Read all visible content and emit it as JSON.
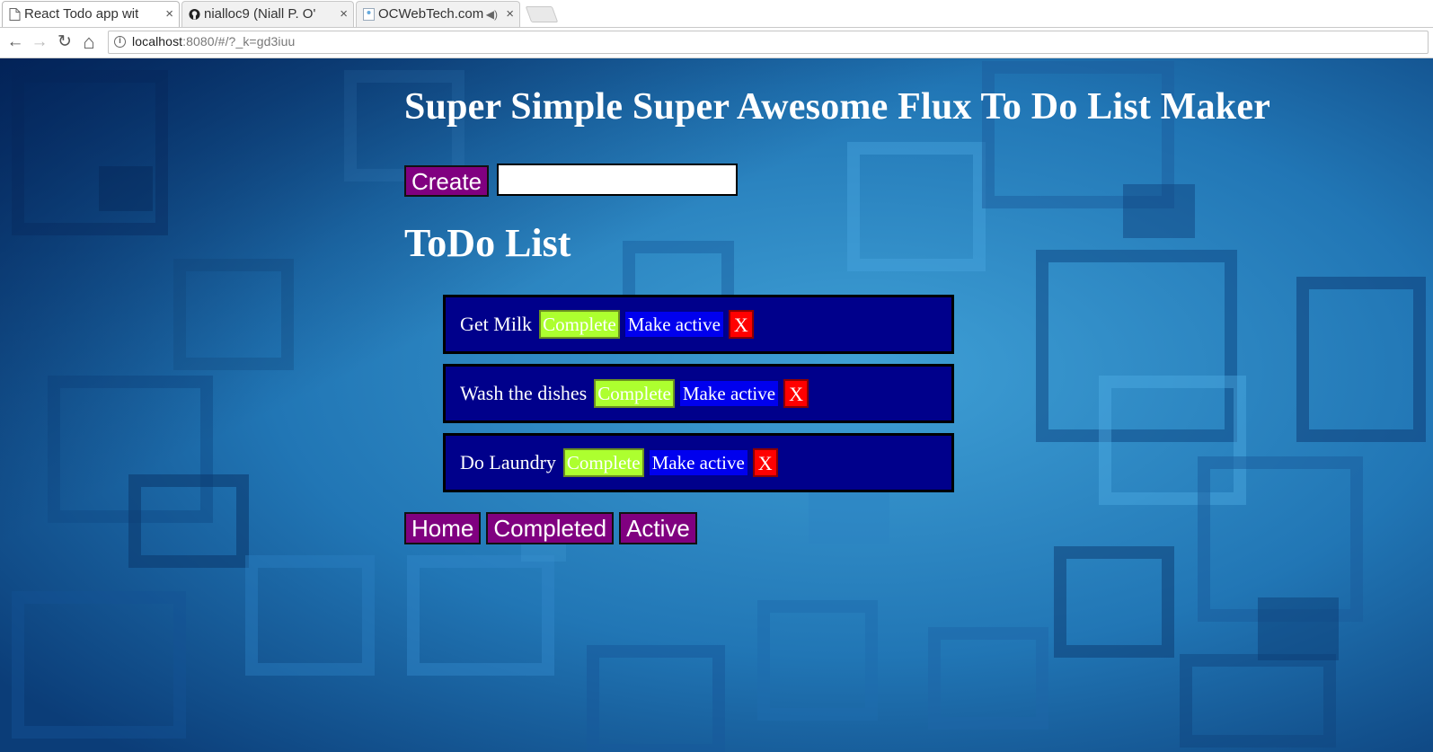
{
  "browser": {
    "tabs": [
      {
        "title": "React Todo app wit",
        "icon": "document-icon",
        "active": true
      },
      {
        "title": "nialloc9 (Niall P. O'",
        "icon": "github-icon",
        "active": false
      },
      {
        "title": "OCWebTech.com",
        "icon": "page-icon",
        "active": false,
        "audio": "speaker-icon"
      }
    ],
    "close_glyph": "×",
    "audio_glyph": "◀)",
    "url_host": "localhost",
    "url_path": ":8080/#/?_k=gd3iuu",
    "back_glyph": "←",
    "forward_glyph": "→",
    "reload_glyph": "↻",
    "home_glyph": "⌂"
  },
  "page": {
    "title": "Super Simple Super Awesome Flux To Do List Maker",
    "create_label": "Create",
    "input_value": "",
    "list_title": "ToDo List",
    "todos": [
      {
        "text": "Get Milk",
        "complete_label": "Complete",
        "active_label": "Make active",
        "delete_label": "X"
      },
      {
        "text": "Wash the dishes",
        "complete_label": "Complete",
        "active_label": "Make active",
        "delete_label": "X"
      },
      {
        "text": "Do Laundry",
        "complete_label": "Complete",
        "active_label": "Make active",
        "delete_label": "X"
      }
    ],
    "filters": [
      "Home",
      "Completed",
      "Active"
    ]
  },
  "colors": {
    "purple_button": "#800080",
    "todo_background": "#00008b",
    "complete_button": "#adff2f",
    "active_button": "#0000ee",
    "delete_button": "#ff0000"
  }
}
